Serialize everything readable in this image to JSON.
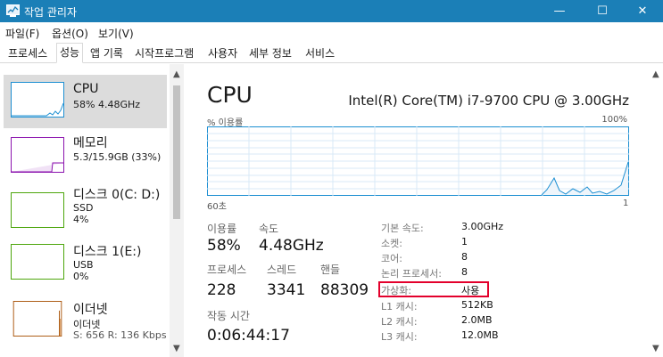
{
  "titlebar": {
    "title": "작업 관리자",
    "min": "—",
    "max": "☐",
    "close": "✕"
  },
  "menu": {
    "file": "파일(F)",
    "options": "옵션(O)",
    "view": "보기(V)"
  },
  "tabs": [
    "프로세스",
    "성능",
    "앱 기록",
    "시작프로그램",
    "사용자",
    "세부 정보",
    "서비스"
  ],
  "sidebar": {
    "items": [
      {
        "title": "CPU",
        "sub1": "58% 4.48GHz",
        "sub2": "",
        "sub3": "",
        "color": "#1d8fd2"
      },
      {
        "title": "메모리",
        "sub1": "5.3/15.9GB (33%)",
        "sub2": "",
        "sub3": "",
        "color": "#8b12ae"
      },
      {
        "title": "디스크 0(C: D:)",
        "sub1": "SSD",
        "sub2": "4%",
        "sub3": "",
        "color": "#4da60c"
      },
      {
        "title": "디스크 1(E:)",
        "sub1": "USB",
        "sub2": "0%",
        "sub3": "",
        "color": "#4da60c"
      },
      {
        "title": "이더넷",
        "sub1": "이더넷",
        "sub2": "S: 656 R: 136 Kbps",
        "sub3": "",
        "color": "#a74f01"
      }
    ]
  },
  "main": {
    "title": "CPU",
    "cpu_name": "Intel(R) Core(TM) i7-9700 CPU @ 3.00GHz",
    "graph_label_left": "% 이용률",
    "graph_label_right": "100%",
    "graph_bottom_left": "60초",
    "graph_bottom_right": "1",
    "utilization_label": "이용률",
    "utilization": "58%",
    "speed_label": "속도",
    "speed": "4.48GHz",
    "processes_label": "프로세스",
    "processes": "228",
    "threads_label": "스레드",
    "threads": "3341",
    "handles_label": "핸들",
    "handles": "88309",
    "uptime_label": "작동 시간",
    "uptime": "0:06:44:17",
    "info": [
      {
        "label": "기본 속도:",
        "value": "3.00GHz"
      },
      {
        "label": "소켓:",
        "value": "1"
      },
      {
        "label": "코어:",
        "value": "8"
      },
      {
        "label": "논리 프로세서:",
        "value": "8"
      },
      {
        "label": "가상화:",
        "value": "사용"
      },
      {
        "label": "L1 캐시:",
        "value": "512KB"
      },
      {
        "label": "L2 캐시:",
        "value": "2.0MB"
      },
      {
        "label": "L3 캐시:",
        "value": "12.0MB"
      }
    ]
  }
}
